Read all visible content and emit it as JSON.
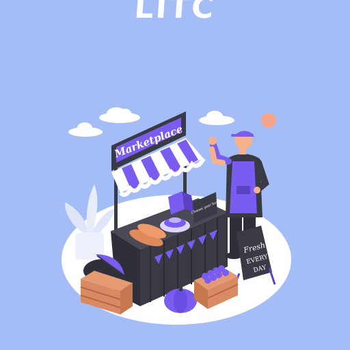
{
  "brand": {
    "title": "LITC"
  },
  "illustration": {
    "stall_sign": "Marketplace",
    "price_board": "Choose your box",
    "easel_sign": {
      "line1": "Fresh",
      "line2": "EVERY",
      "line3": "DAY"
    }
  },
  "colors": {
    "background": "#a4bdf6",
    "accent_purple": "#7b5cf0",
    "dark": "#3a3a45",
    "cloud": "#ffffff"
  }
}
